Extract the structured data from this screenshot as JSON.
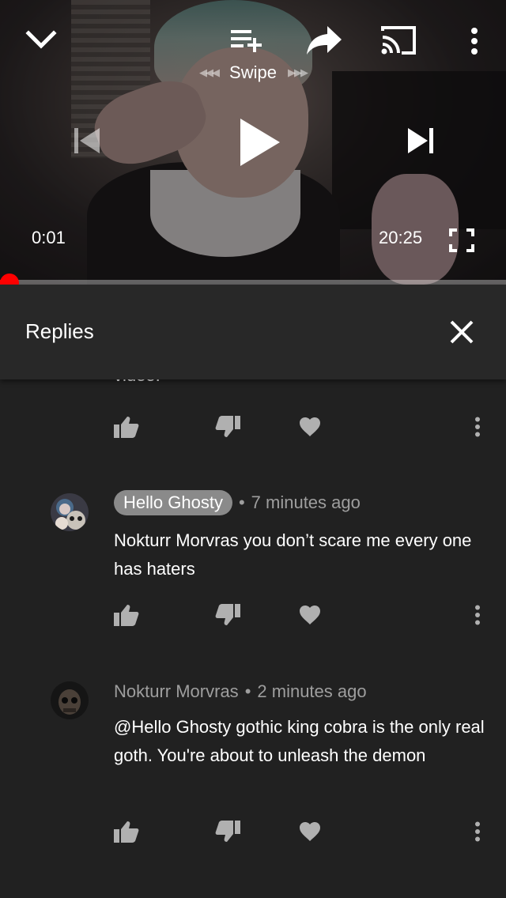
{
  "player": {
    "swipe_label": "Swipe",
    "swipe_arrows_left": "◀◀◀",
    "swipe_arrows_right": "▶▶▶",
    "time_current": "0:01",
    "time_total": "20:25",
    "progress": 0.0008,
    "colors": {
      "progress": "#ff0000"
    }
  },
  "replies": {
    "title": "Replies",
    "truncated_text": "video."
  },
  "comments": [
    {
      "author": "Hello Ghosty",
      "time": "7 minutes ago",
      "text": "Nokturr Morvras you don’t scare me  every one has haters",
      "highlighted_author": true
    },
    {
      "author": "Nokturr Morvras",
      "time": "2 minutes ago",
      "text": "@Hello Ghosty gothic king cobra is the only real goth. You're about to unleash the demon",
      "highlighted_author": false
    }
  ],
  "icons": {
    "collapse": "chevron-down-icon",
    "queue": "add-to-queue-icon",
    "share": "share-icon",
    "cast": "cast-icon",
    "more": "more-vert-icon",
    "previous": "skip-previous-icon",
    "play": "play-icon",
    "next": "skip-next-icon",
    "fullscreen": "fullscreen-icon",
    "close": "close-icon",
    "like": "thumb-up-icon",
    "dislike": "thumb-down-icon",
    "heart": "heart-icon"
  }
}
